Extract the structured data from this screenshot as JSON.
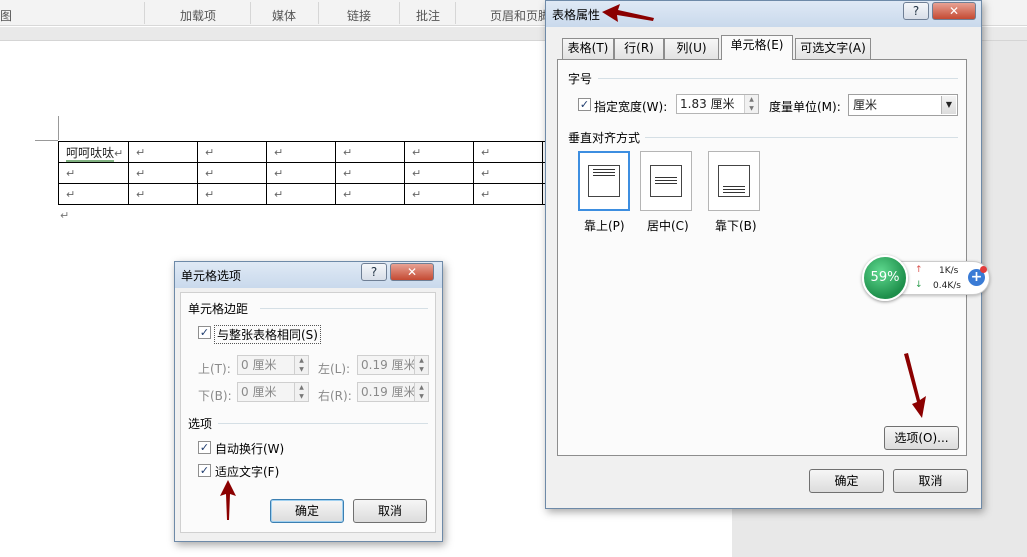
{
  "ribbon": {
    "groups": [
      "图",
      "加载项",
      "媒体",
      "链接",
      "批注",
      "页眉和页脚"
    ]
  },
  "document": {
    "first_cell_text": "呵呵呔呔",
    "para_mark": "↵",
    "rows": [
      [
        "↵",
        "↵",
        "↵",
        "↵",
        "↵",
        "↵",
        "↵"
      ],
      [
        "↵",
        "↵",
        "↵",
        "↵",
        "↵",
        "↵",
        "↵",
        "↵"
      ],
      [
        "↵",
        "↵",
        "↵",
        "↵",
        "↵",
        "↵",
        "↵",
        "↵"
      ]
    ]
  },
  "table_props": {
    "title": "表格属性",
    "help": "?",
    "close": "✕",
    "tabs": [
      "表格(T)",
      "行(R)",
      "列(U)",
      "单元格(E)",
      "可选文字(A)"
    ],
    "active_tab": "单元格(E)",
    "size_section": "字号",
    "specify_width_label": "指定宽度(W):",
    "specify_width_checked": "✓",
    "width_value": "1.83 厘米",
    "measure_label": "度量单位(M):",
    "measure_value": "厘米",
    "vertical_section": "垂直对齐方式",
    "align_options": [
      "靠上(P)",
      "居中(C)",
      "靠下(B)"
    ],
    "options_button": "选项(O)...",
    "ok": "确定",
    "cancel": "取消"
  },
  "cell_options": {
    "title": "单元格选项",
    "help": "?",
    "close": "✕",
    "margin_section": "单元格边距",
    "same_as_table": "与整张表格相同(S)",
    "same_checked": "✓",
    "top_label": "上(T):",
    "top_value": "0 厘米",
    "left_label": "左(L):",
    "left_value": "0.19 厘米",
    "bottom_label": "下(B):",
    "bottom_value": "0 厘米",
    "right_label": "右(R):",
    "right_value": "0.19 厘米",
    "options_section": "选项",
    "wrap_text": "自动换行(W)",
    "wrap_checked": "✓",
    "fit_text": "适应文字(F)",
    "fit_checked": "✓",
    "ok": "确定",
    "cancel": "取消"
  },
  "net_widget": {
    "percent": "59%",
    "up_rate": "1K/s",
    "down_rate": "0.4K/s",
    "up_arrow": "↑",
    "down_arrow": "↓",
    "plus": "+"
  },
  "colors": {
    "annotation_arrow": "#8b0000",
    "selection_blue": "#3d8ee0"
  }
}
